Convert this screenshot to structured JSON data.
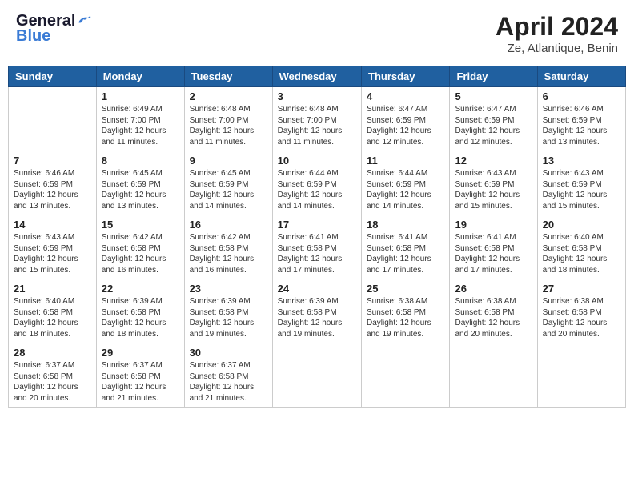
{
  "header": {
    "logo_general": "General",
    "logo_blue": "Blue",
    "month_year": "April 2024",
    "location": "Ze, Atlantique, Benin"
  },
  "weekdays": [
    "Sunday",
    "Monday",
    "Tuesday",
    "Wednesday",
    "Thursday",
    "Friday",
    "Saturday"
  ],
  "weeks": [
    [
      {
        "day": "",
        "sunrise": "",
        "sunset": "",
        "daylight": ""
      },
      {
        "day": "1",
        "sunrise": "Sunrise: 6:49 AM",
        "sunset": "Sunset: 7:00 PM",
        "daylight": "Daylight: 12 hours and 11 minutes."
      },
      {
        "day": "2",
        "sunrise": "Sunrise: 6:48 AM",
        "sunset": "Sunset: 7:00 PM",
        "daylight": "Daylight: 12 hours and 11 minutes."
      },
      {
        "day": "3",
        "sunrise": "Sunrise: 6:48 AM",
        "sunset": "Sunset: 7:00 PM",
        "daylight": "Daylight: 12 hours and 11 minutes."
      },
      {
        "day": "4",
        "sunrise": "Sunrise: 6:47 AM",
        "sunset": "Sunset: 6:59 PM",
        "daylight": "Daylight: 12 hours and 12 minutes."
      },
      {
        "day": "5",
        "sunrise": "Sunrise: 6:47 AM",
        "sunset": "Sunset: 6:59 PM",
        "daylight": "Daylight: 12 hours and 12 minutes."
      },
      {
        "day": "6",
        "sunrise": "Sunrise: 6:46 AM",
        "sunset": "Sunset: 6:59 PM",
        "daylight": "Daylight: 12 hours and 13 minutes."
      }
    ],
    [
      {
        "day": "7",
        "sunrise": "Sunrise: 6:46 AM",
        "sunset": "Sunset: 6:59 PM",
        "daylight": "Daylight: 12 hours and 13 minutes."
      },
      {
        "day": "8",
        "sunrise": "Sunrise: 6:45 AM",
        "sunset": "Sunset: 6:59 PM",
        "daylight": "Daylight: 12 hours and 13 minutes."
      },
      {
        "day": "9",
        "sunrise": "Sunrise: 6:45 AM",
        "sunset": "Sunset: 6:59 PM",
        "daylight": "Daylight: 12 hours and 14 minutes."
      },
      {
        "day": "10",
        "sunrise": "Sunrise: 6:44 AM",
        "sunset": "Sunset: 6:59 PM",
        "daylight": "Daylight: 12 hours and 14 minutes."
      },
      {
        "day": "11",
        "sunrise": "Sunrise: 6:44 AM",
        "sunset": "Sunset: 6:59 PM",
        "daylight": "Daylight: 12 hours and 14 minutes."
      },
      {
        "day": "12",
        "sunrise": "Sunrise: 6:43 AM",
        "sunset": "Sunset: 6:59 PM",
        "daylight": "Daylight: 12 hours and 15 minutes."
      },
      {
        "day": "13",
        "sunrise": "Sunrise: 6:43 AM",
        "sunset": "Sunset: 6:59 PM",
        "daylight": "Daylight: 12 hours and 15 minutes."
      }
    ],
    [
      {
        "day": "14",
        "sunrise": "Sunrise: 6:43 AM",
        "sunset": "Sunset: 6:59 PM",
        "daylight": "Daylight: 12 hours and 15 minutes."
      },
      {
        "day": "15",
        "sunrise": "Sunrise: 6:42 AM",
        "sunset": "Sunset: 6:58 PM",
        "daylight": "Daylight: 12 hours and 16 minutes."
      },
      {
        "day": "16",
        "sunrise": "Sunrise: 6:42 AM",
        "sunset": "Sunset: 6:58 PM",
        "daylight": "Daylight: 12 hours and 16 minutes."
      },
      {
        "day": "17",
        "sunrise": "Sunrise: 6:41 AM",
        "sunset": "Sunset: 6:58 PM",
        "daylight": "Daylight: 12 hours and 17 minutes."
      },
      {
        "day": "18",
        "sunrise": "Sunrise: 6:41 AM",
        "sunset": "Sunset: 6:58 PM",
        "daylight": "Daylight: 12 hours and 17 minutes."
      },
      {
        "day": "19",
        "sunrise": "Sunrise: 6:41 AM",
        "sunset": "Sunset: 6:58 PM",
        "daylight": "Daylight: 12 hours and 17 minutes."
      },
      {
        "day": "20",
        "sunrise": "Sunrise: 6:40 AM",
        "sunset": "Sunset: 6:58 PM",
        "daylight": "Daylight: 12 hours and 18 minutes."
      }
    ],
    [
      {
        "day": "21",
        "sunrise": "Sunrise: 6:40 AM",
        "sunset": "Sunset: 6:58 PM",
        "daylight": "Daylight: 12 hours and 18 minutes."
      },
      {
        "day": "22",
        "sunrise": "Sunrise: 6:39 AM",
        "sunset": "Sunset: 6:58 PM",
        "daylight": "Daylight: 12 hours and 18 minutes."
      },
      {
        "day": "23",
        "sunrise": "Sunrise: 6:39 AM",
        "sunset": "Sunset: 6:58 PM",
        "daylight": "Daylight: 12 hours and 19 minutes."
      },
      {
        "day": "24",
        "sunrise": "Sunrise: 6:39 AM",
        "sunset": "Sunset: 6:58 PM",
        "daylight": "Daylight: 12 hours and 19 minutes."
      },
      {
        "day": "25",
        "sunrise": "Sunrise: 6:38 AM",
        "sunset": "Sunset: 6:58 PM",
        "daylight": "Daylight: 12 hours and 19 minutes."
      },
      {
        "day": "26",
        "sunrise": "Sunrise: 6:38 AM",
        "sunset": "Sunset: 6:58 PM",
        "daylight": "Daylight: 12 hours and 20 minutes."
      },
      {
        "day": "27",
        "sunrise": "Sunrise: 6:38 AM",
        "sunset": "Sunset: 6:58 PM",
        "daylight": "Daylight: 12 hours and 20 minutes."
      }
    ],
    [
      {
        "day": "28",
        "sunrise": "Sunrise: 6:37 AM",
        "sunset": "Sunset: 6:58 PM",
        "daylight": "Daylight: 12 hours and 20 minutes."
      },
      {
        "day": "29",
        "sunrise": "Sunrise: 6:37 AM",
        "sunset": "Sunset: 6:58 PM",
        "daylight": "Daylight: 12 hours and 21 minutes."
      },
      {
        "day": "30",
        "sunrise": "Sunrise: 6:37 AM",
        "sunset": "Sunset: 6:58 PM",
        "daylight": "Daylight: 12 hours and 21 minutes."
      },
      {
        "day": "",
        "sunrise": "",
        "sunset": "",
        "daylight": ""
      },
      {
        "day": "",
        "sunrise": "",
        "sunset": "",
        "daylight": ""
      },
      {
        "day": "",
        "sunrise": "",
        "sunset": "",
        "daylight": ""
      },
      {
        "day": "",
        "sunrise": "",
        "sunset": "",
        "daylight": ""
      }
    ]
  ]
}
